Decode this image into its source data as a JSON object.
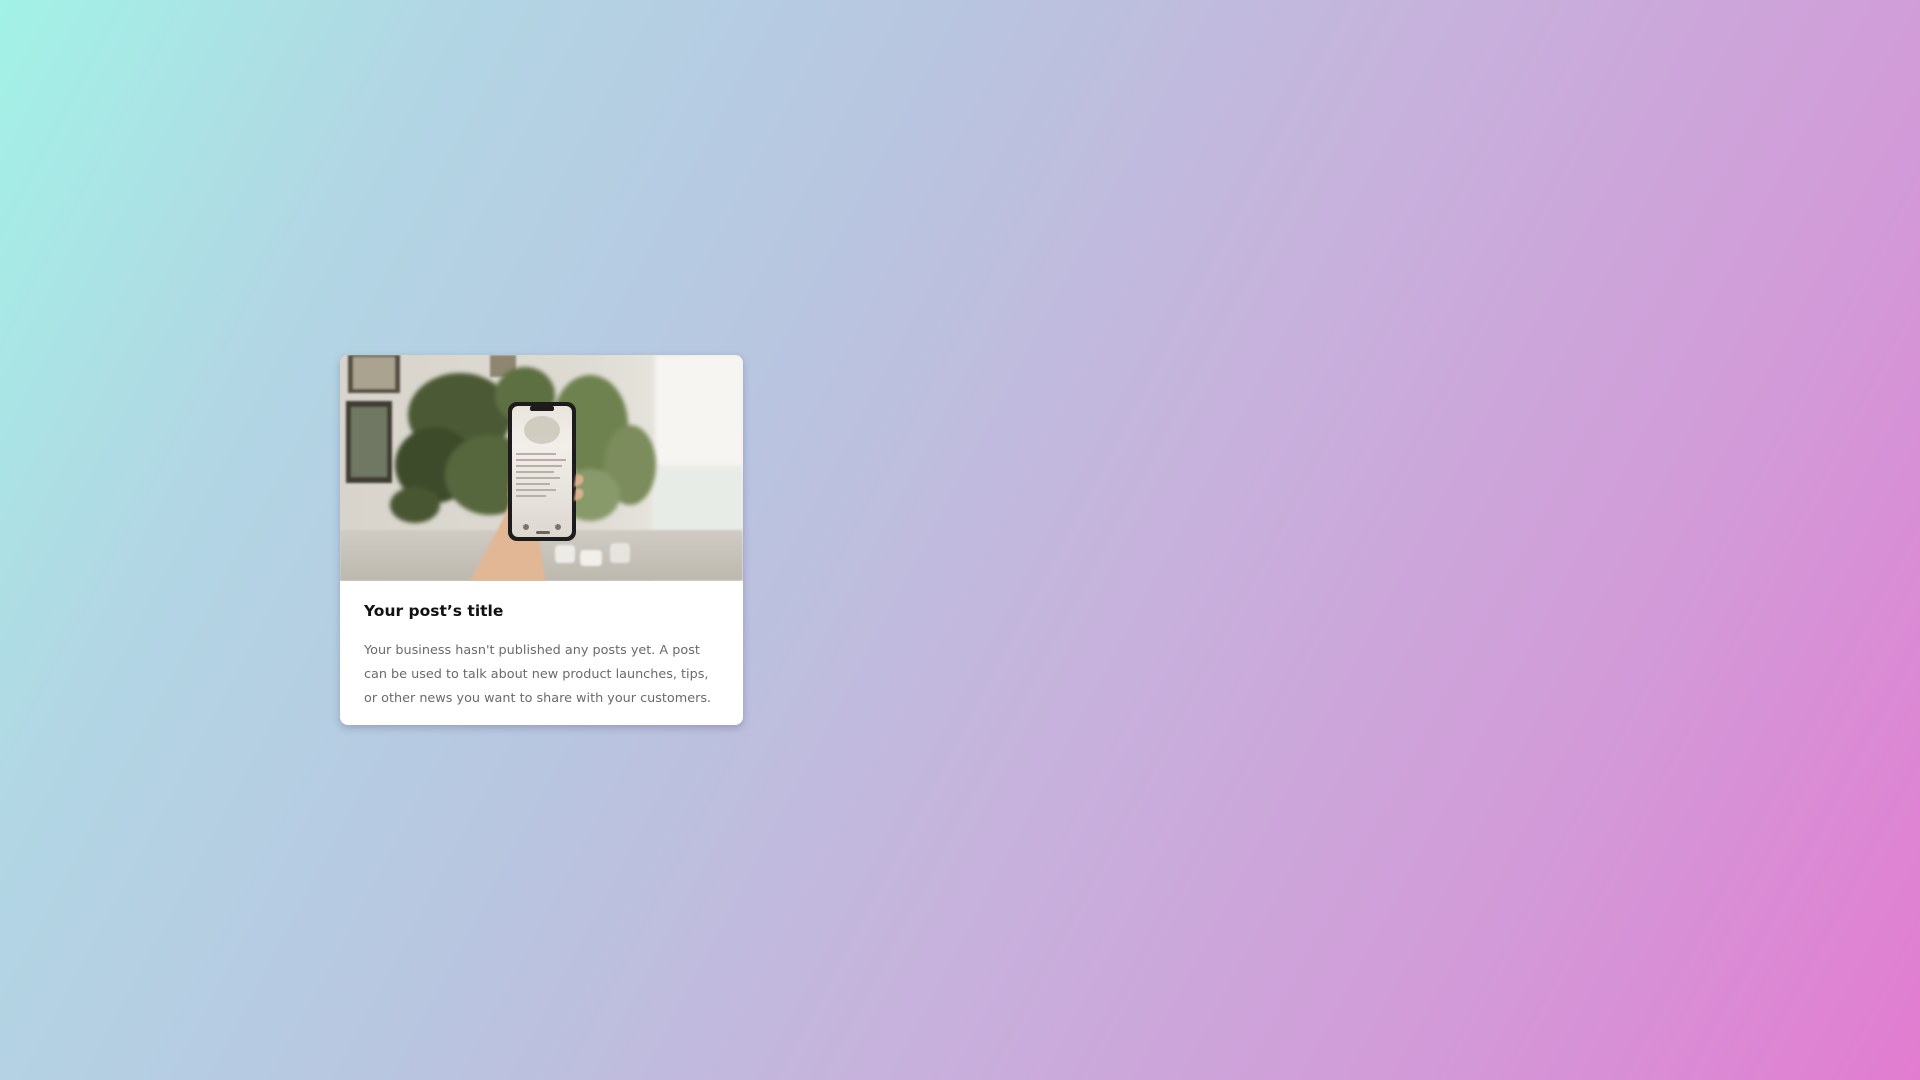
{
  "post_card": {
    "image_alt": "hand holding phone near houseplants",
    "title": "Your post’s title",
    "description": "Your business hasn't published any posts yet. A post can be used to talk about new product launches, tips, or other news you want to share with your customers."
  }
}
